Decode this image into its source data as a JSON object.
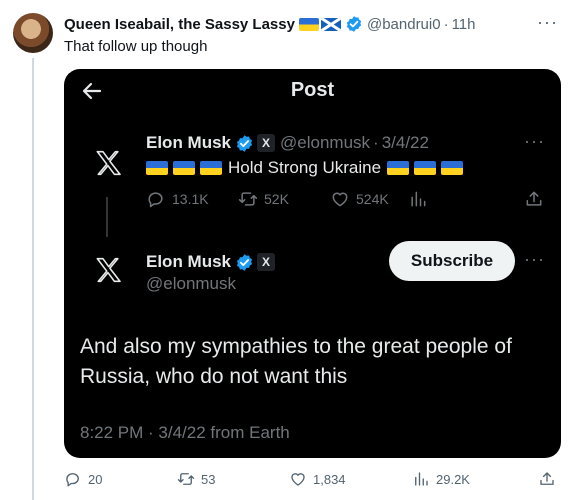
{
  "tweet": {
    "author_name": "Queen Iseabail, the Sassy Lassy",
    "handle": "@bandrui0",
    "separator": "·",
    "time": "11h",
    "text": "That follow up though",
    "stats": {
      "replies": "20",
      "reposts": "53",
      "likes": "1,834",
      "views": "29.2K"
    }
  },
  "embed": {
    "title": "Post",
    "first_post": {
      "name": "Elon Musk",
      "badge": "X",
      "handle": "@elonmusk",
      "separator": "·",
      "date": "3/4/22",
      "text": "Hold Strong Ukraine",
      "stats": {
        "replies": "13.1K",
        "reposts": "52K",
        "likes": "524K"
      }
    },
    "second_post": {
      "name": "Elon Musk",
      "badge": "X",
      "handle": "@elonmusk",
      "subscribe_label": "Subscribe",
      "text": "And also my sympathies to the great people of Russia, who do not want this",
      "meta": "8:22 PM · 3/4/22 from Earth"
    }
  },
  "icons": {
    "more": "more-dots-icon",
    "back": "back-arrow-icon",
    "logo": "x-logo-icon",
    "verified": "verified-badge-icon",
    "reply": "reply-icon",
    "repost": "repost-icon",
    "like": "heart-icon",
    "views": "views-icon",
    "share": "share-icon"
  },
  "colors": {
    "verified": "#1d9bf0",
    "embed_background": "#000000",
    "muted_text": "#536471",
    "flag_blue": "#2b6fd6",
    "flag_yellow": "#ffd21f"
  }
}
